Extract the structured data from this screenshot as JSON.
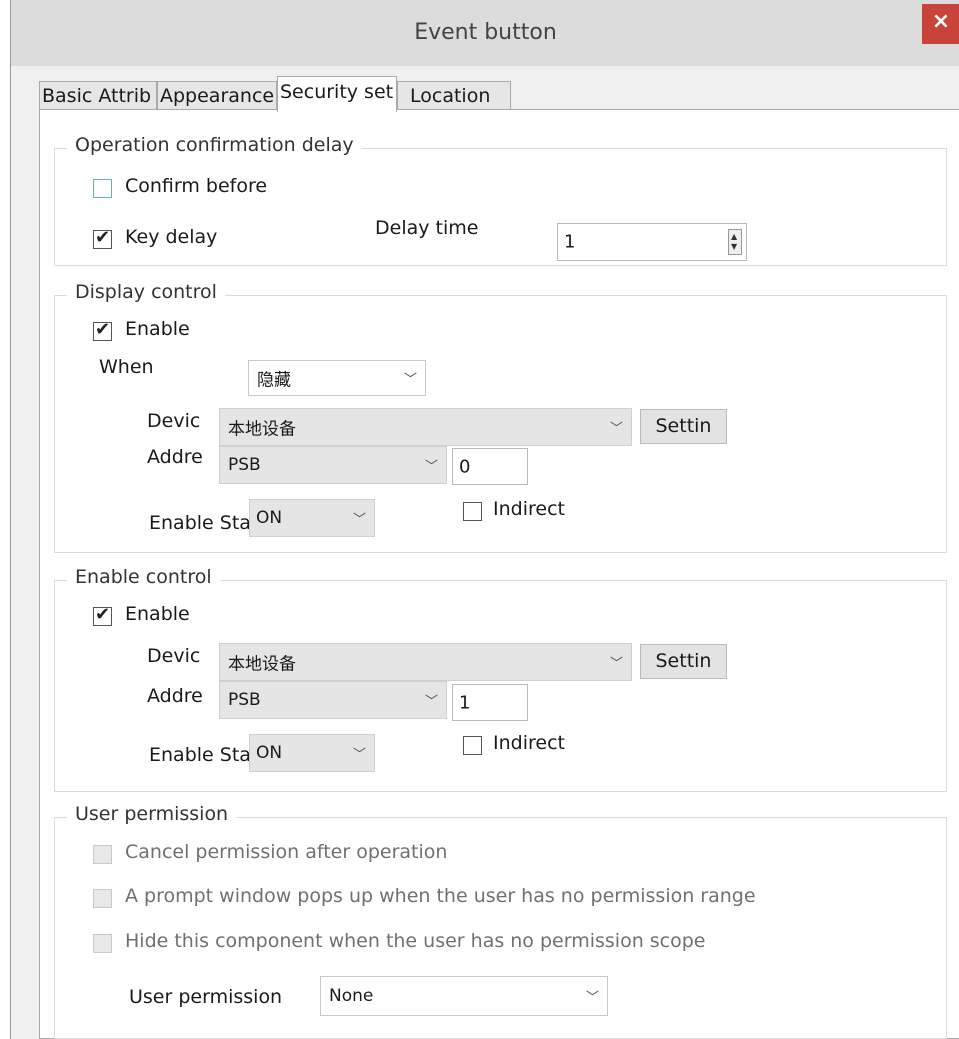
{
  "window": {
    "title": "Event button",
    "close_glyph": "×"
  },
  "tabs": [
    "Basic Attrib",
    "Appearance",
    "Security set",
    "Location"
  ],
  "operation_group": {
    "legend": "Operation confirmation delay",
    "confirm_before": {
      "label": "Confirm before",
      "checked": false
    },
    "key_delay": {
      "label": "Key delay",
      "checked": true
    },
    "delay_time_label": "Delay time",
    "delay_time_value": "1"
  },
  "display_group": {
    "legend": "Display control",
    "enable": {
      "label": "Enable",
      "checked": true
    },
    "when_label": "When",
    "when_value": "隐藏",
    "device_label": "Devic",
    "device_value": "本地设备",
    "settings_label": "Settin",
    "address_label": "Addre",
    "address_type": "PSB",
    "address_value": "0",
    "enable_state_label": "Enable Sta",
    "enable_state_value": "ON",
    "indirect": {
      "label": "Indirect",
      "checked": false
    }
  },
  "enable_group": {
    "legend": "Enable control",
    "enable": {
      "label": "Enable",
      "checked": true
    },
    "device_label": "Devic",
    "device_value": "本地设备",
    "settings_label": "Settin",
    "address_label": "Addre",
    "address_type": "PSB",
    "address_value": "1",
    "enable_state_label": "Enable Sta",
    "enable_state_value": "ON",
    "indirect": {
      "label": "Indirect",
      "checked": false
    }
  },
  "permission_group": {
    "legend": "User permission",
    "options": [
      "Cancel permission after operation",
      "A prompt window pops up when the user has no permission range",
      "Hide this component when the user has no permission scope"
    ],
    "user_permission_label": "User permission",
    "user_permission_value": "None"
  },
  "icons": {
    "check": "✔",
    "dropdown": "chevron-down-icon",
    "spinner": "spinner-icon"
  },
  "colors": {
    "close": "#c8433a",
    "titlebar": "#dcdcdc",
    "checkbox_blue": "#6aa6d8"
  }
}
